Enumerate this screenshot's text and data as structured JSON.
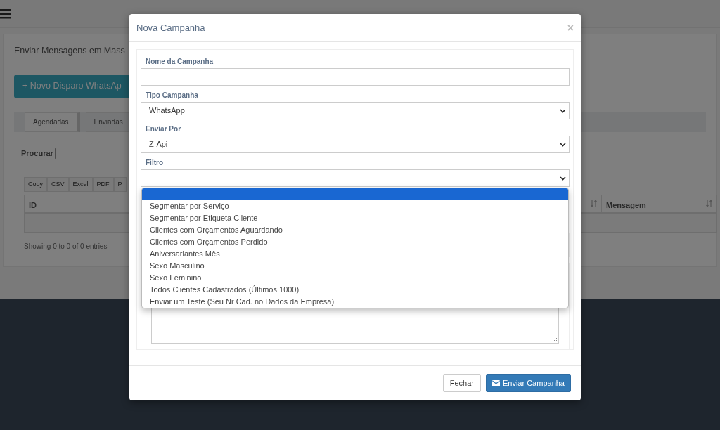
{
  "page": {
    "title": "Enviar Mensagens em Mass",
    "new_button": "+ Novo Disparo WhatsAp",
    "tabs": [
      {
        "label": "Agendadas",
        "selected": true
      },
      {
        "label": "Enviadas",
        "selected": false
      }
    ],
    "search_label": "Procurar",
    "export_buttons": [
      "Copy",
      "CSV",
      "Excel",
      "PDF",
      "P"
    ],
    "table": {
      "columns": [
        "ID",
        "Mensagem"
      ]
    },
    "info": "Showing 0 to 0 of 0 entries"
  },
  "modal": {
    "title": "Nova Campanha",
    "close": "×",
    "fields": [
      {
        "label": "Nome da Campanha",
        "kind": "text"
      },
      {
        "label": "Tipo Campanha",
        "kind": "select",
        "value": "WhatsApp"
      },
      {
        "label": "Enviar Por",
        "kind": "select",
        "value": "Z-Api"
      },
      {
        "label": "Filtro",
        "kind": "select",
        "expanded": true,
        "options": [
          {
            "selected": true
          },
          {
            "text": "Segmentar por Serviço",
            "selected": false
          },
          {
            "text": "Segmentar por Etiqueta Cliente",
            "selected": false
          },
          {
            "text": "Clientes com Orçamentos Aguardando",
            "selected": false
          },
          {
            "text": "Clientes com Orçamentos Perdido",
            "selected": false
          },
          {
            "text": "Aniversariantes Mês",
            "selected": false
          },
          {
            "text": "Sexo Masculino",
            "selected": false
          },
          {
            "text": "Sexo Feminino",
            "selected": false
          },
          {
            "text": "Todos Clientes Cadastrados (Últimos 1000)",
            "selected": false
          },
          {
            "text": "Enviar um Teste (Seu Nr Cad. no Dados da Empresa)",
            "selected": false
          }
        ]
      }
    ],
    "buttons": [
      {
        "label": "Fechar",
        "kind": "default"
      },
      {
        "label": "Enviar Campanha",
        "kind": "primary"
      }
    ]
  }
}
